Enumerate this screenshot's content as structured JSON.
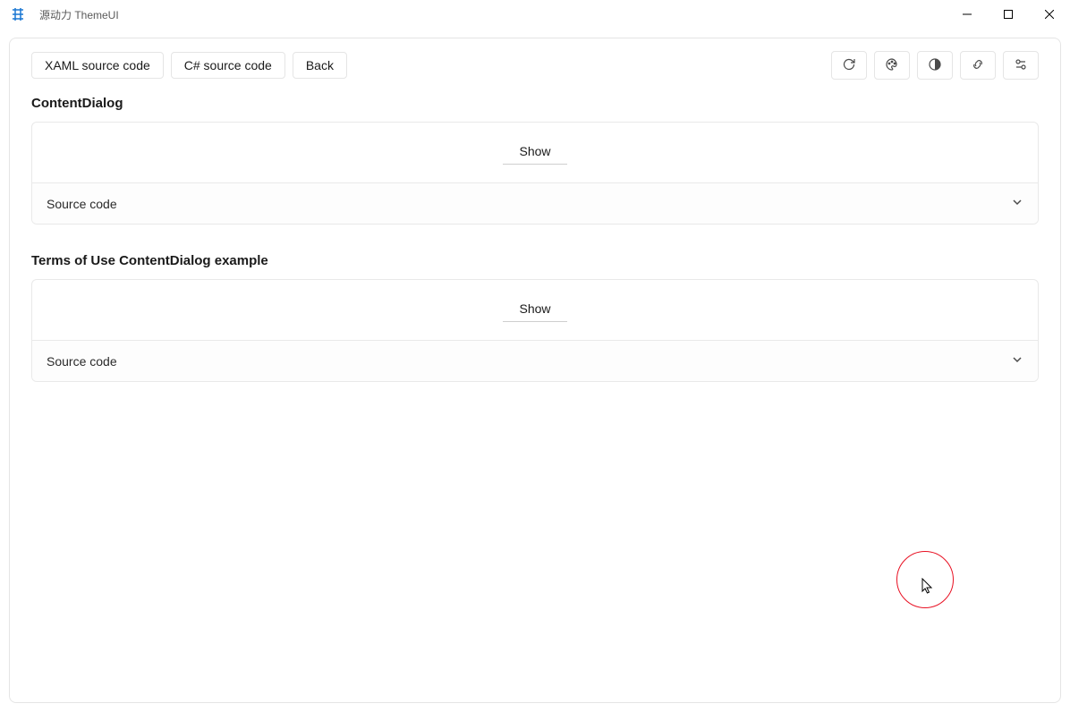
{
  "window": {
    "title": "源动力 ThemeUI"
  },
  "toolbar": {
    "xaml_label": "XAML source code",
    "csharp_label": "C# source code",
    "back_label": "Back"
  },
  "sections": [
    {
      "title": "ContentDialog",
      "show_label": "Show",
      "source_label": "Source code"
    },
    {
      "title": "Terms of Use ContentDialog example",
      "show_label": "Show",
      "source_label": "Source code"
    }
  ]
}
